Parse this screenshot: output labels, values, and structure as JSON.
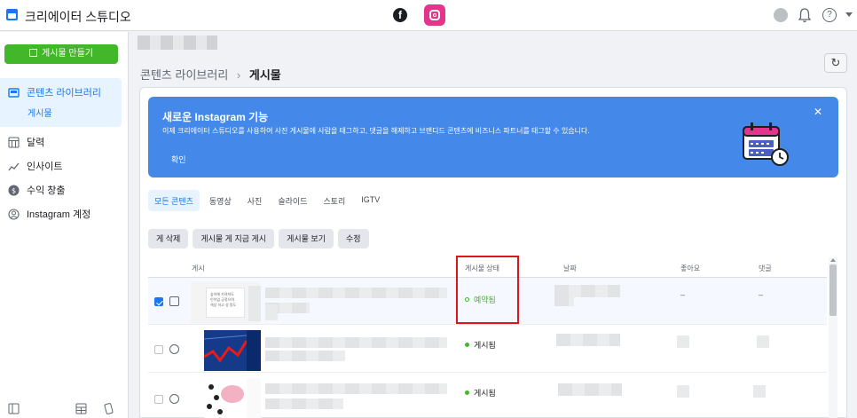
{
  "app": {
    "title": "크리에이터 스튜디오"
  },
  "colors": {
    "accent": "#1877f2",
    "create_button": "#42b72a",
    "banner": "#4489ea",
    "scheduled": "#42b72a",
    "published": "#42b72a",
    "highlight": "#e0141e"
  },
  "topbar": {
    "icons": [
      "app-icon",
      "facebook-icon",
      "instagram-icon",
      "avatar",
      "bell-icon",
      "help-icon",
      "chevron-down-icon"
    ],
    "help_glyph": "?"
  },
  "sidebar": {
    "create_label": "게시물 만들기",
    "items": [
      {
        "label": "콘텐츠 라이브러리",
        "icon": "library-icon"
      },
      {
        "label": "달력",
        "icon": "calendar-icon"
      },
      {
        "label": "인사이트",
        "icon": "insights-icon"
      },
      {
        "label": "수익 창출",
        "icon": "dollar-icon"
      },
      {
        "label": "Instagram 계정",
        "icon": "account-icon"
      }
    ],
    "sub_item": "게시물"
  },
  "breadcrumb": {
    "parent": "콘텐츠 라이브러리",
    "separator": "›",
    "current": "게시물"
  },
  "banner": {
    "title": "새로운 Instagram 기능",
    "body": "이제 크리에이터 스튜디오를 사용하여 사진 게시물에 사람을 태그하고, 댓글을 해제하고 브랜디드 콘텐츠에 비즈니스 파트너를 태그할 수 있습니다.",
    "confirm": "확인",
    "close": "✕"
  },
  "tabs": [
    "모든 콘텐츠",
    "동영상",
    "사진",
    "슬라이드",
    "스토리",
    "IGTV"
  ],
  "actions": [
    "게 삭제",
    "게시물 게 지금 게시",
    "게시물 보기",
    "수정"
  ],
  "table": {
    "headers": {
      "post": "게시",
      "status": "게시물 상태",
      "date": "날짜",
      "likes": "좋아요",
      "comments": "댓글"
    },
    "rows": [
      {
        "selected": true,
        "status": "예약됨",
        "likes": "–",
        "comments": "–"
      },
      {
        "selected": false,
        "status": "게시됨",
        "likes": "",
        "comments": ""
      },
      {
        "selected": false,
        "status": "게시됨",
        "likes": "",
        "comments": ""
      }
    ],
    "thumb1_text": "숲이에 가려져도\n인이없 긍정으며\n색상 하고 성 정도"
  }
}
